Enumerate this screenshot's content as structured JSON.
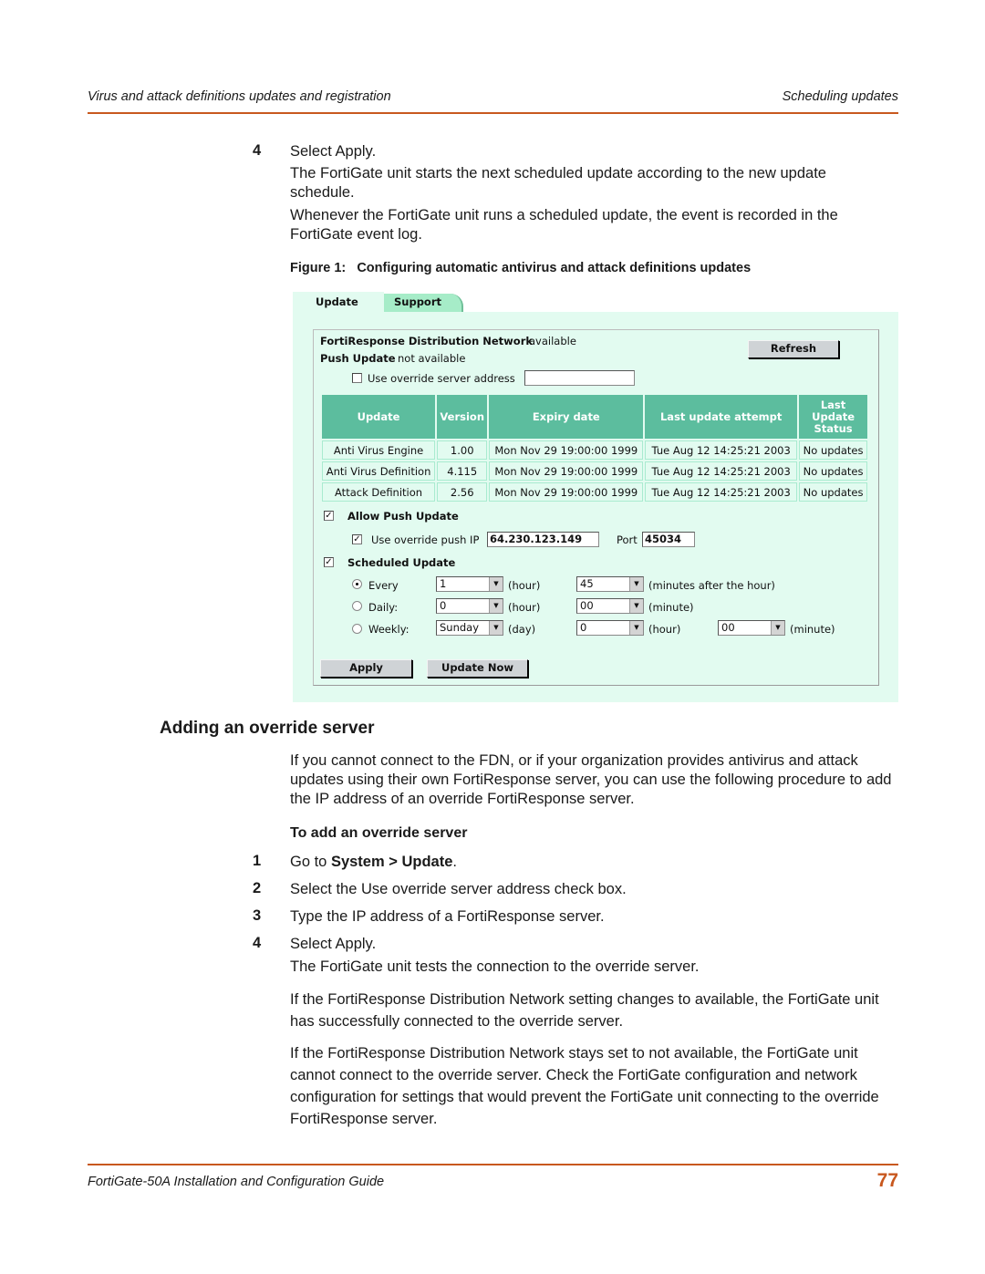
{
  "header": {
    "left": "Virus and attack definitions updates and registration",
    "right": "Scheduling updates"
  },
  "steps_top": {
    "num": "4",
    "text": "Select Apply.",
    "p1": "The FortiGate unit starts the next scheduled update according to the new update schedule.",
    "p2": "Whenever the FortiGate unit runs a scheduled update, the event is recorded in the FortiGate event log."
  },
  "figure": {
    "caption": "Figure 1:   Configuring automatic antivirus and attack definitions updates",
    "tabs": [
      {
        "label": "Update",
        "active": true
      },
      {
        "label": "Support",
        "active": false
      }
    ],
    "fdn_label": "FortiResponse Distribution Network",
    "fdn_value": "available",
    "push_label": "Push Update",
    "push_value": "not available",
    "refresh_button": "Refresh",
    "override_server_label": "Use override server address",
    "override_server_checked": false,
    "override_server_value": "",
    "table": {
      "headers": [
        "Update",
        "Version",
        "Expiry date",
        "Last update attempt",
        "Last Update Status"
      ],
      "rows": [
        [
          "Anti Virus Engine",
          "1.00",
          "Mon Nov 29 19:00:00 1999",
          "Tue Aug 12 14:25:21 2003",
          "No updates"
        ],
        [
          "Anti Virus Definition",
          "4.115",
          "Mon Nov 29 19:00:00 1999",
          "Tue Aug 12 14:25:21 2003",
          "No updates"
        ],
        [
          "Attack Definition",
          "2.56",
          "Mon Nov 29 19:00:00 1999",
          "Tue Aug 12 14:25:21 2003",
          "No updates"
        ]
      ]
    },
    "allow_push_label": "Allow Push Update",
    "allow_push_checked": true,
    "override_push_label": "Use override push IP",
    "override_push_checked": true,
    "override_push_ip": "64.230.123.149",
    "port_label": "Port",
    "port_value": "45034",
    "scheduled_label": "Scheduled Update",
    "scheduled_checked": true,
    "schedule": {
      "every": {
        "label": "Every",
        "selected": true,
        "value1": "1",
        "unit1": "(hour)",
        "value2": "45",
        "unit2": "(minutes after the hour)"
      },
      "daily": {
        "label": "Daily:",
        "selected": false,
        "value1": "0",
        "unit1": "(hour)",
        "value2": "00",
        "unit2": "(minute)"
      },
      "weekly": {
        "label": "Weekly:",
        "selected": false,
        "value1": "Sunday",
        "unit1": "(day)",
        "value2": "0",
        "unit2": "(hour)",
        "value3": "00",
        "unit3": "(minute)"
      }
    },
    "apply_button": "Apply",
    "update_now_button": "Update Now"
  },
  "section": {
    "title": "Adding an override server",
    "intro": "If you cannot connect to the FDN, or if your organization provides antivirus and attack updates using their own FortiResponse server, you can use the following procedure to add the IP address of an override FortiResponse server.",
    "proc_title": "To add an override server",
    "steps": [
      {
        "num": "1",
        "pre": "Go to ",
        "bold": "System > Update",
        "post": "."
      },
      {
        "num": "2",
        "text": "Select the Use override server address check box."
      },
      {
        "num": "3",
        "text": "Type the IP address of a FortiResponse server."
      },
      {
        "num": "4",
        "text": "Select Apply."
      }
    ],
    "after_step4": "The FortiGate unit tests the connection to the override server.",
    "p_available": "If the FortiResponse Distribution Network setting changes to available, the FortiGate unit has successfully connected to the override server.",
    "p_not_available": "If the FortiResponse Distribution Network stays set to not available, the FortiGate unit cannot connect to the override server. Check the FortiGate configuration and network configuration for settings that would prevent the FortiGate unit connecting to the override FortiResponse server."
  },
  "footer": {
    "left": "FortiGate-50A Installation and Configuration Guide",
    "page_number": "77"
  }
}
